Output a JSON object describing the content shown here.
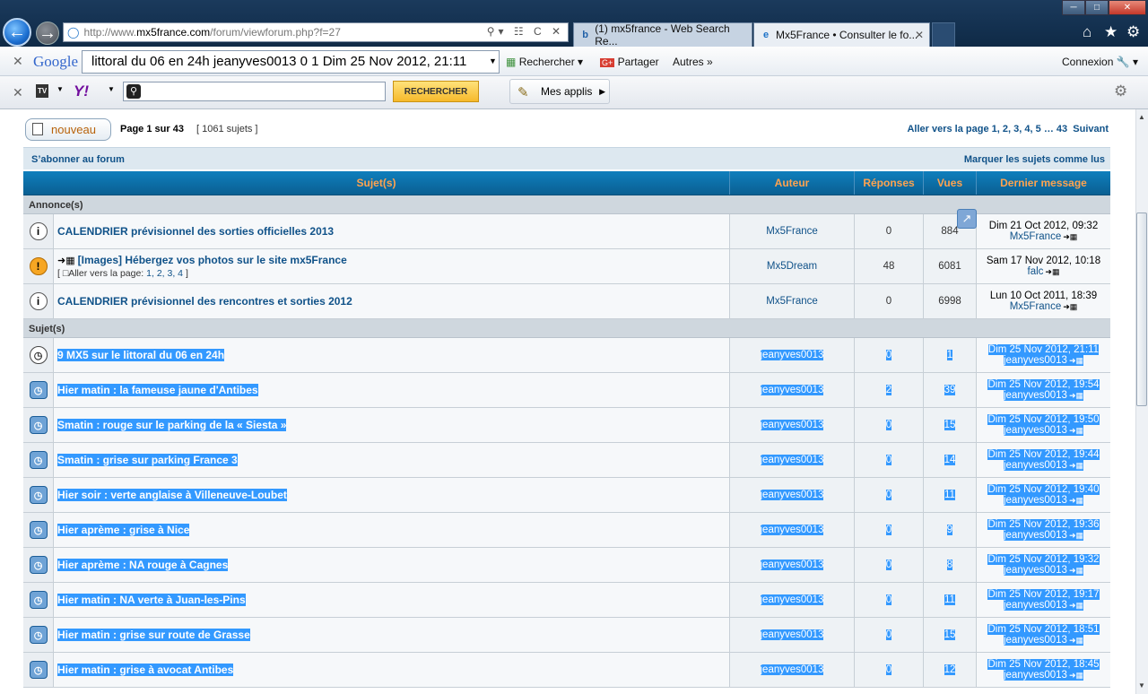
{
  "browser": {
    "url_pre": "http://www.",
    "url_host": "mx5france.com",
    "url_post": "/forum/viewforum.php?f=27",
    "tabs": [
      {
        "label": "(1) mx5france - Web Search Re...",
        "icon": "bing-icon"
      },
      {
        "label": "Mx5France • Consulter le fo...",
        "icon": "ie-icon"
      }
    ],
    "google_logo": "Google",
    "google_search_value": "littoral du 06 en 24h jeanyves0013 0 1 Dim 25 Nov 2012, 21:11",
    "google_rechercher": "Rechercher",
    "google_partager": "Partager",
    "google_autres": "Autres",
    "google_connexion": "Connexion",
    "yahoo_logo": "Y!",
    "yahoo_button": "RECHERCHER",
    "mes_applis": "Mes applis"
  },
  "forum": {
    "new_button": "nouveau",
    "page_info": "Page 1 sur 43",
    "topic_count": "[ 1061 sujets ]",
    "pagination_label": "Aller vers la page",
    "pagination_pages": [
      "1",
      "2",
      "3",
      "4",
      "5",
      "43"
    ],
    "pagination_next": "Suivant",
    "subscribe": "S’abonner au forum",
    "mark_read": "Marquer les sujets comme lus",
    "columns": [
      "Sujet(s)",
      "Auteur",
      "Réponses",
      "Vues",
      "Dernier message"
    ],
    "section_announcements": "Annonce(s)",
    "section_topics": "Sujet(s)",
    "announcements": [
      {
        "title": "CALENDRIER prévisionnel des sorties officielles 2013",
        "author": "Mx5France",
        "replies": "0",
        "views": "884",
        "last_date": "Dim 21 Oct 2012, 09:32",
        "last_by": "Mx5France",
        "icon": "announcement-icon"
      },
      {
        "title": "[Images] Hébergez vos photos sur le site mx5France",
        "author": "Mx5Dream",
        "replies": "48",
        "views": "6081",
        "last_date": "Sam 17 Nov 2012, 10:18",
        "last_by": "falc",
        "icon": "global-announcement-icon",
        "goto_label": "Aller vers la page:",
        "goto_pages": "1, 2, 3, 4"
      },
      {
        "title": "CALENDRIER prévisionnel des rencontres et sorties 2012",
        "author": "Mx5France",
        "replies": "0",
        "views": "6998",
        "last_date": "Lun 10 Oct 2011, 18:39",
        "last_by": "Mx5France",
        "icon": "announcement-icon"
      }
    ],
    "topics": [
      {
        "title": "9 MX5 sur le littoral du 06 en 24h",
        "author": "jeanyves0013",
        "replies": "0",
        "views": "1",
        "last_date": "Dim 25 Nov 2012, 21:11",
        "last_by": "jeanyves0013"
      },
      {
        "title": "Hier matin : la fameuse jaune d'Antibes",
        "author": "jeanyves0013",
        "replies": "2",
        "views": "39",
        "last_date": "Dim 25 Nov 2012, 19:54",
        "last_by": "jeanyves0013"
      },
      {
        "title": "Smatin : rouge sur le parking de la « Siesta »",
        "author": "jeanyves0013",
        "replies": "0",
        "views": "15",
        "last_date": "Dim 25 Nov 2012, 19:50",
        "last_by": "jeanyves0013"
      },
      {
        "title": "Smatin : grise sur parking France 3",
        "author": "jeanyves0013",
        "replies": "0",
        "views": "14",
        "last_date": "Dim 25 Nov 2012, 19:44",
        "last_by": "jeanyves0013"
      },
      {
        "title": "Hier soir : verte anglaise à Villeneuve-Loubet",
        "author": "jeanyves0013",
        "replies": "0",
        "views": "11",
        "last_date": "Dim 25 Nov 2012, 19:40",
        "last_by": "jeanyves0013"
      },
      {
        "title": "Hier aprème : grise à Nice",
        "author": "jeanyves0013",
        "replies": "0",
        "views": "9",
        "last_date": "Dim 25 Nov 2012, 19:36",
        "last_by": "jeanyves0013"
      },
      {
        "title": "Hier aprème : NA rouge à Cagnes",
        "author": "jeanyves0013",
        "replies": "0",
        "views": "8",
        "last_date": "Dim 25 Nov 2012, 19:32",
        "last_by": "jeanyves0013"
      },
      {
        "title": "Hier matin : NA verte à Juan-les-Pins",
        "author": "jeanyves0013",
        "replies": "0",
        "views": "11",
        "last_date": "Dim 25 Nov 2012, 19:17",
        "last_by": "jeanyves0013"
      },
      {
        "title": "Hier matin : grise sur route de Grasse",
        "author": "jeanyves0013",
        "replies": "0",
        "views": "15",
        "last_date": "Dim 25 Nov 2012, 18:51",
        "last_by": "jeanyves0013"
      },
      {
        "title": "Hier matin : grise à avocat Antibes",
        "author": "jeanyves0013",
        "replies": "0",
        "views": "12",
        "last_date": "Dim 25 Nov 2012, 18:45",
        "last_by": "jeanyves0013"
      }
    ]
  },
  "colors": {
    "link": "#105289",
    "header_text": "#ffa34f",
    "header_bg": "#0f7fbd",
    "selection": "#3399ff"
  }
}
